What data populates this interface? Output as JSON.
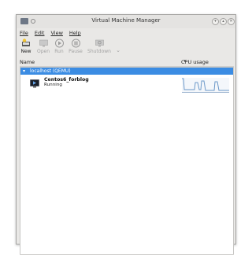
{
  "window": {
    "title": "Virtual Machine Manager"
  },
  "menu": {
    "file": "File",
    "edit": "Edit",
    "view": "View",
    "help": "Help"
  },
  "toolbar": {
    "new": "New",
    "open": "Open",
    "run": "Run",
    "pause": "Pause",
    "shutdown": "Shutdown"
  },
  "columns": {
    "name": "Name",
    "cpu": "CPU usage"
  },
  "group": {
    "label": "localhost (QEMU)"
  },
  "vm": {
    "name": "Centos6_forblog",
    "status": "Running"
  },
  "colors": {
    "selection": "#3b8ce3",
    "window_bg": "#e9e8e6"
  }
}
